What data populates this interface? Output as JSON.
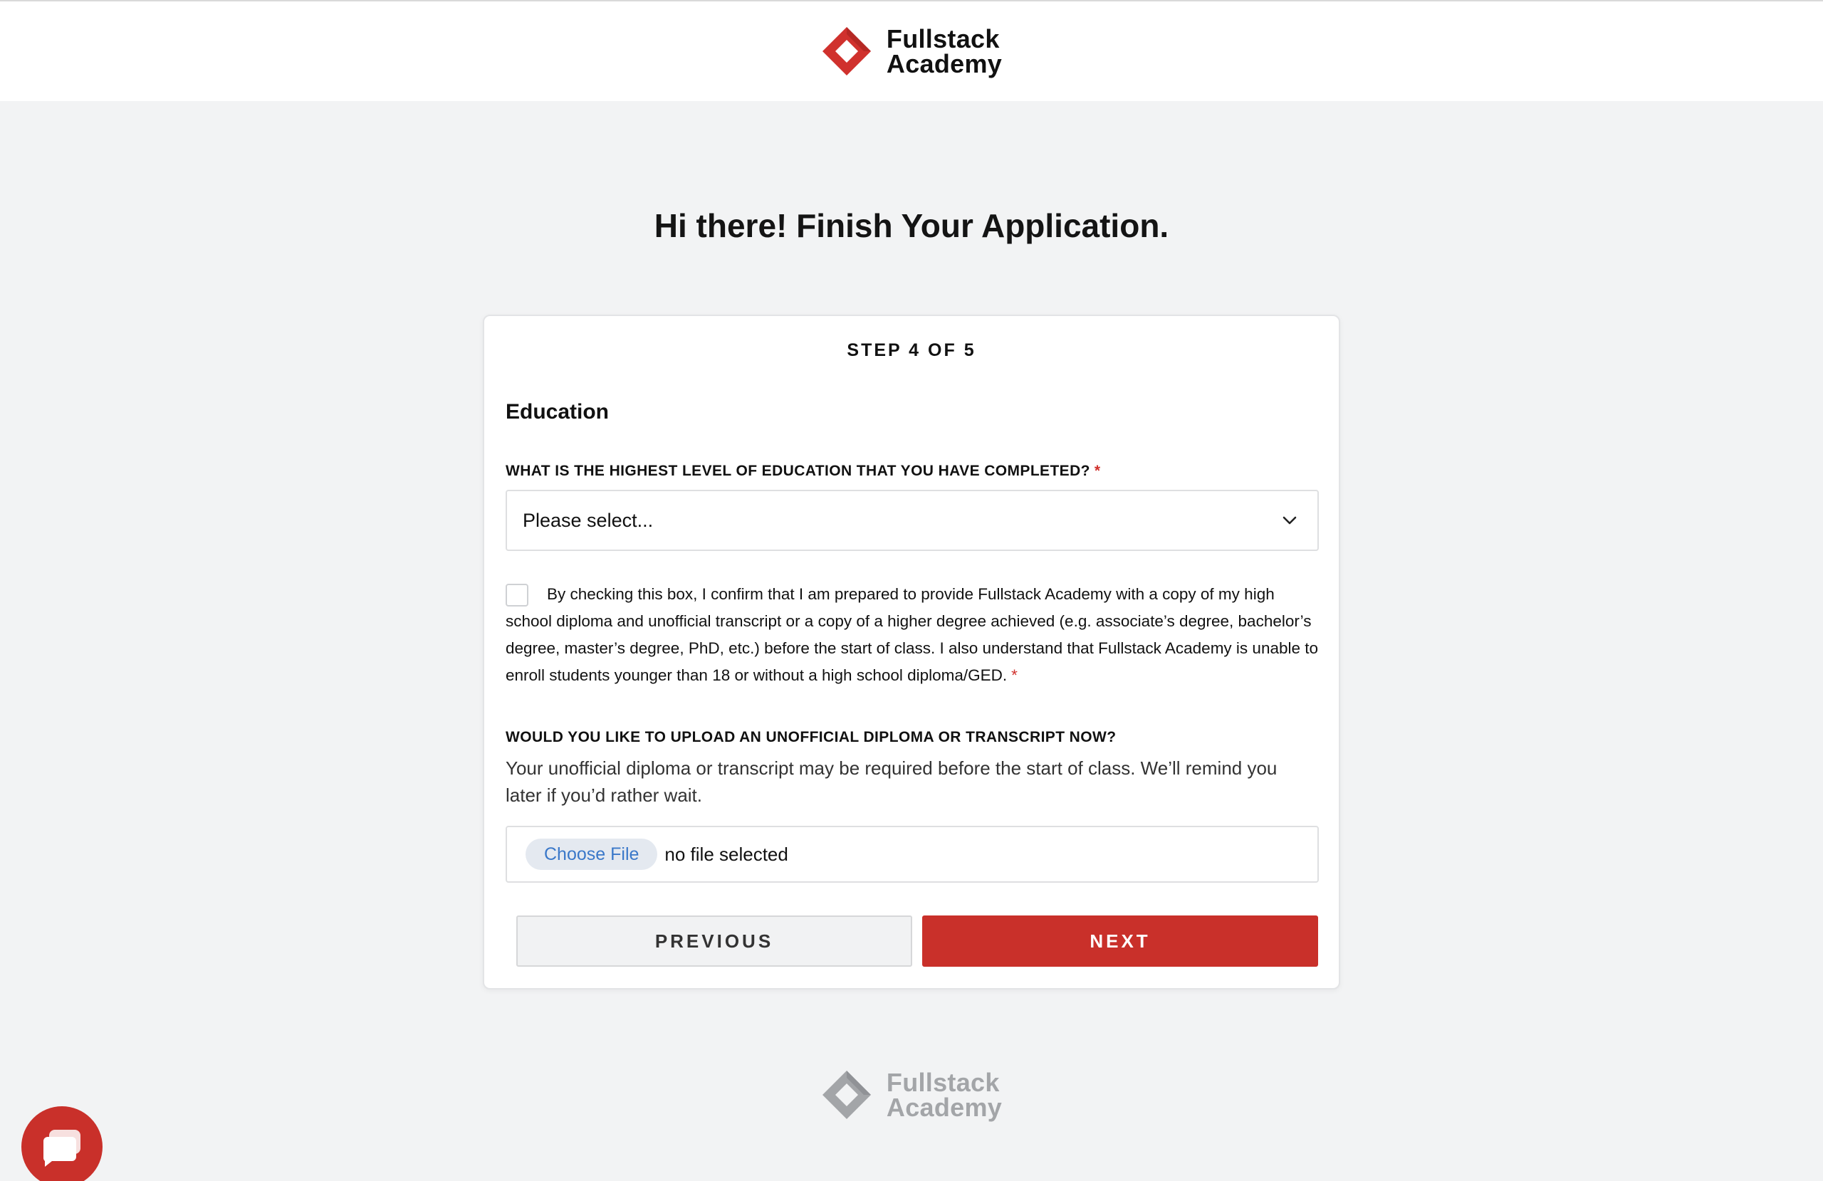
{
  "brand": {
    "name_line1": "Fullstack",
    "name_line2": "Academy",
    "color": "#d0312d"
  },
  "page": {
    "heading": "Hi there! Finish Your Application."
  },
  "form": {
    "step": "STEP 4 OF 5",
    "section_title": "Education",
    "education_question": "WHAT IS THE HIGHEST LEVEL OF EDUCATION THAT YOU HAVE COMPLETED?",
    "required_mark": "*",
    "education_select_value": "Please select...",
    "consent_text": "By checking this box, I confirm that I am prepared to provide Fullstack Academy with a copy of my high school diploma and unofficial transcript or a copy of a higher degree achieved (e.g. associate’s degree, bachelor’s degree, master’s degree, PhD, etc.) before the start of class. I also understand that Fullstack Academy is unable to enroll students younger than 18 or without a high school diploma/GED.",
    "upload_question": "WOULD YOU LIKE TO UPLOAD AN UNOFFICIAL DIPLOMA OR TRANSCRIPT NOW?",
    "upload_description": "Your unofficial diploma or transcript may be required before the start of class. We’ll remind you later if you’d rather wait.",
    "choose_file_label": "Choose File",
    "no_file_text": "no file selected",
    "previous_label": "PREVIOUS",
    "next_label": "NEXT"
  },
  "icons": {
    "chevron": "chevron-down-icon",
    "chat": "chat-icon",
    "logo": "fullstack-logo-icon"
  }
}
